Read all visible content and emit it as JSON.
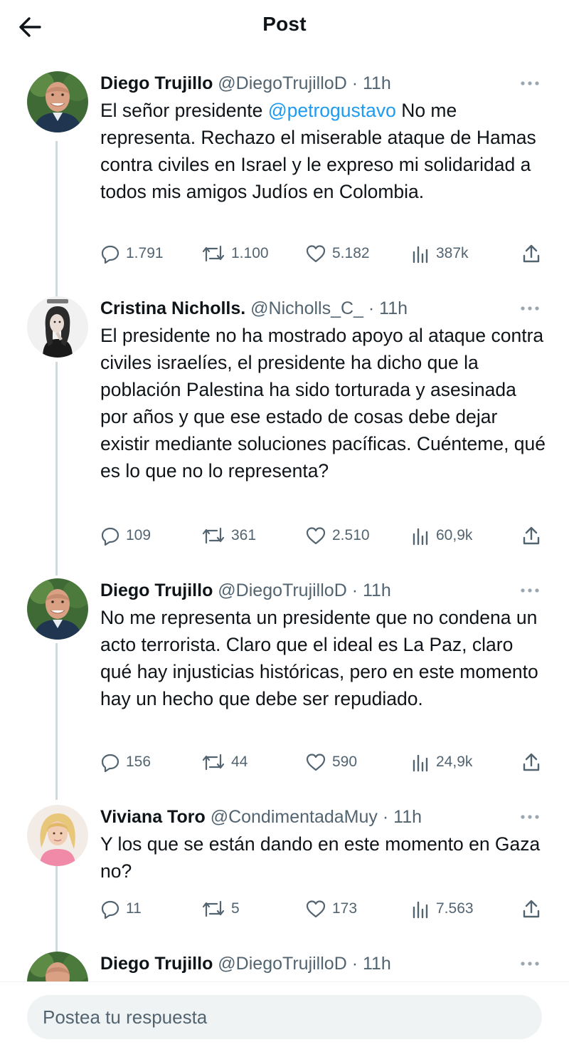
{
  "header": {
    "title": "Post"
  },
  "tweets": [
    {
      "name": "Diego Trujillo",
      "handle": "@DiegoTrujilloD",
      "sep": "·",
      "time": "11h",
      "text_parts": [
        "El señor presidente ",
        "@petrogustavo",
        " No me representa. Rechazo el miserable ataque de Hamas contra civiles en Israel y le expreso mi solidaridad a todos mis amigos Judíos en Colombia."
      ],
      "replies": "1.791",
      "reposts": "1.100",
      "likes": "5.182",
      "views": "387k"
    },
    {
      "name": "Cristina Nicholls.",
      "handle": "@Nicholls_C_",
      "sep": "·",
      "time": "11h",
      "text": "El presidente no ha mostrado apoyo al ataque contra civiles israelíes, el presidente ha dicho que la población Palestina ha sido torturada y asesinada por años y que ese estado de cosas debe dejar existir mediante soluciones pacíficas. Cuénteme, qué es lo que no lo representa?",
      "replies": "109",
      "reposts": "361",
      "likes": "2.510",
      "views": "60,9k"
    },
    {
      "name": "Diego Trujillo",
      "handle": "@DiegoTrujilloD",
      "sep": "·",
      "time": "11h",
      "text": "No me representa un presidente que no condena un acto terrorista. Claro que el ideal es La Paz, claro qué hay injusticias históricas, pero en este momento hay un hecho que debe ser repudiado.",
      "replies": "156",
      "reposts": "44",
      "likes": "590",
      "views": "24,9k"
    },
    {
      "name": "Viviana Toro",
      "handle": "@CondimentadaMuy",
      "sep": "·",
      "time": "11h",
      "text": "Y los que se están dando en este momento en Gaza no?",
      "replies": "11",
      "reposts": "5",
      "likes": "173",
      "views": "7.563"
    },
    {
      "name": "Diego Trujillo",
      "handle": "@DiegoTrujilloD",
      "sep": "·",
      "time": "11h"
    }
  ],
  "reply": {
    "placeholder": "Postea tu respuesta"
  },
  "colors": {
    "accent": "#1d9bf0",
    "muted": "#536471",
    "thread": "#cfd9de"
  }
}
